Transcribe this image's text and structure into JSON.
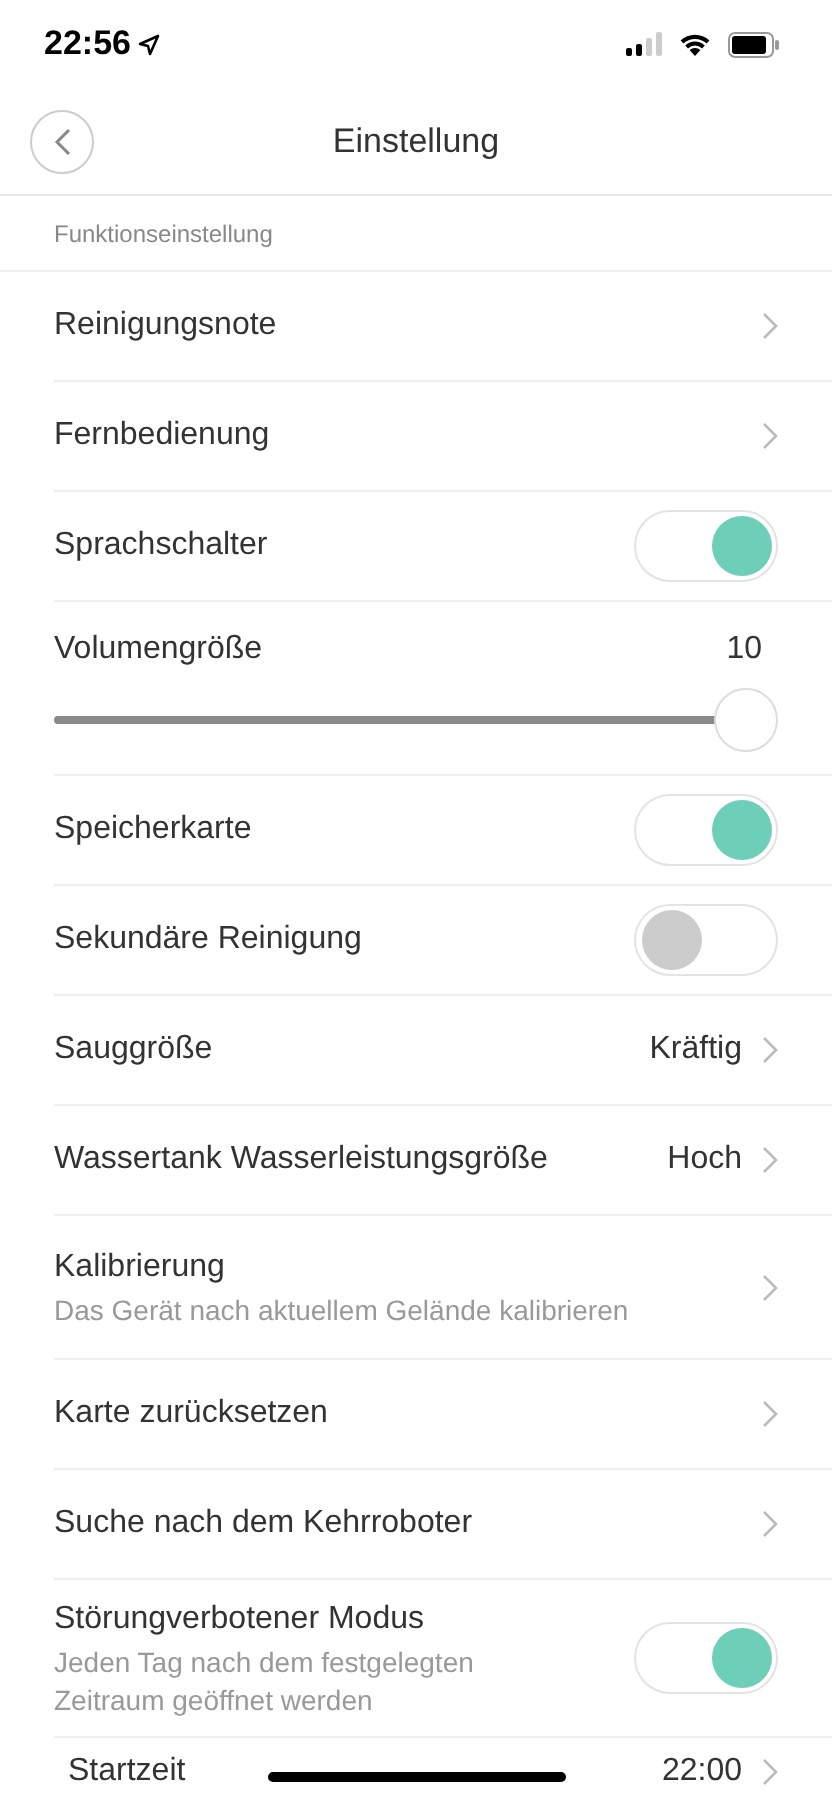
{
  "status_bar": {
    "time": "22:56"
  },
  "header": {
    "title": "Einstellung"
  },
  "section": {
    "title": "Funktionseinstellung"
  },
  "rows": [
    {
      "kind": "link",
      "label": "Reinigungsnote"
    },
    {
      "kind": "link",
      "label": "Fernbedienung"
    },
    {
      "kind": "toggle",
      "label": "Sprachschalter",
      "on": true
    },
    {
      "kind": "slider",
      "label": "Volumengröße",
      "value": "10",
      "level": 1
    },
    {
      "kind": "toggle",
      "label": "Speicherkarte",
      "on": true
    },
    {
      "kind": "toggle",
      "label": "Sekundäre Reinigung",
      "on": false
    },
    {
      "kind": "link",
      "label": "Sauggröße",
      "value": "Kräftig"
    },
    {
      "kind": "link",
      "label": "Wassertank Wasserleistungsgröße",
      "value": "Hoch"
    },
    {
      "kind": "link",
      "label": "Kalibrierung",
      "subtitle": "Das Gerät nach aktuellem Gelände kalibrieren"
    },
    {
      "kind": "link",
      "label": "Karte zurücksetzen"
    },
    {
      "kind": "link",
      "label": "Suche nach dem Kehrroboter"
    },
    {
      "kind": "toggle",
      "label": "Störungverbotener Modus",
      "subtitle": "Jeden Tag nach dem festgelegten Zeitraum geöffnet werden",
      "on": true
    },
    {
      "kind": "link",
      "label": "Startzeit",
      "value": "22:00",
      "indented": true
    }
  ]
}
